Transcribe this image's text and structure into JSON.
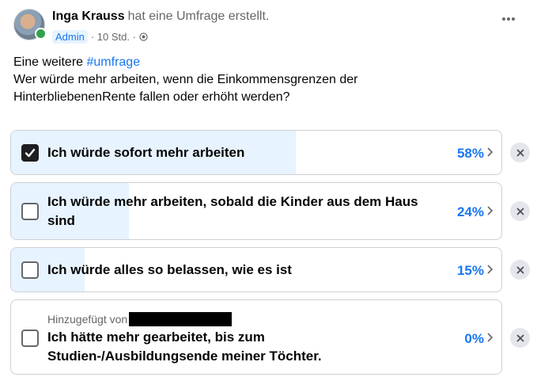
{
  "post": {
    "author": "Inga Krauss",
    "action": "hat eine Umfrage erstellt.",
    "role_badge": "Admin",
    "time_text": "· 10 Std. ·",
    "text_line1_prefix": "Eine weitere ",
    "hashtag": "#umfrage",
    "text_line2": "Wer würde mehr arbeiten, wenn die Einkommensgrenzen der",
    "text_line3": "HinterbliebenenRente fallen oder erhöht werden?"
  },
  "poll": {
    "options": [
      {
        "label": "Ich würde sofort mehr arbeiten",
        "percent_text": "58%",
        "percent": 58,
        "checked": true
      },
      {
        "label_line1": "Ich würde mehr arbeiten, sobald die Kinder aus dem Haus",
        "label_line2": "sind",
        "percent_text": "24%",
        "percent": 24,
        "checked": false
      },
      {
        "label": "Ich würde alles so belassen, wie es ist",
        "percent_text": "15%",
        "percent": 15,
        "checked": false
      },
      {
        "added_by": "Hinzugefügt von",
        "label_line1": "Ich hätte mehr gearbeitet, bis zum",
        "label_line2": "Studien-/Ausbildungsende meiner Töchter.",
        "percent_text": "0%",
        "percent": 0,
        "checked": false
      }
    ]
  },
  "colors": {
    "accent": "#1877f2",
    "fill": "#e7f3ff",
    "online": "#31a24c"
  },
  "icons": {
    "more": "more-horizontal-icon",
    "globe": "globe-icon",
    "chevron": "chevron-right-icon",
    "remove": "close-icon",
    "check": "checkmark-icon"
  }
}
